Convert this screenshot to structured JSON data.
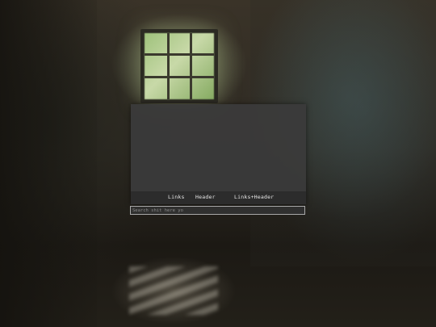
{
  "tabs": [
    {
      "label": "Links"
    },
    {
      "label": "Header"
    },
    {
      "label": "Links+Header"
    }
  ],
  "search": {
    "placeholder": "Search shit here yo",
    "value": ""
  },
  "colors": {
    "panel": "#3a3a3a",
    "tabbar": "#2c2c2c",
    "tab_text": "#e6e6e6",
    "search_border": "#a8a8a8"
  }
}
